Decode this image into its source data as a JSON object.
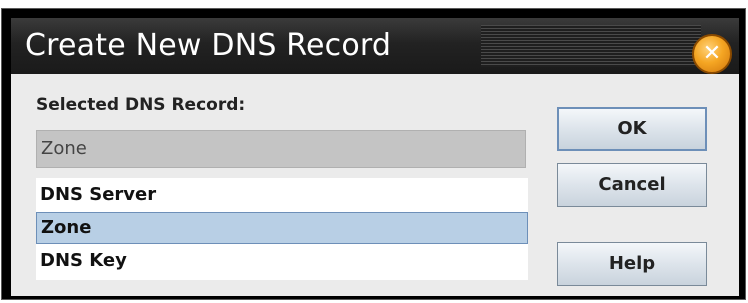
{
  "dialog": {
    "title": "Create New DNS Record",
    "close_icon": "close-icon"
  },
  "form": {
    "selected_label": "Selected DNS Record:",
    "selected_value": "Zone"
  },
  "record_list": {
    "items": [
      {
        "label": "DNS Server"
      },
      {
        "label": "Zone"
      },
      {
        "label": "DNS Key"
      }
    ],
    "selected_index": 1
  },
  "buttons": {
    "ok_label": "OK",
    "cancel_label": "Cancel",
    "help_label": "Help"
  },
  "colors": {
    "titlebar": "#222222",
    "selection": "#b8cfe5",
    "close_button": "#f5a623"
  }
}
